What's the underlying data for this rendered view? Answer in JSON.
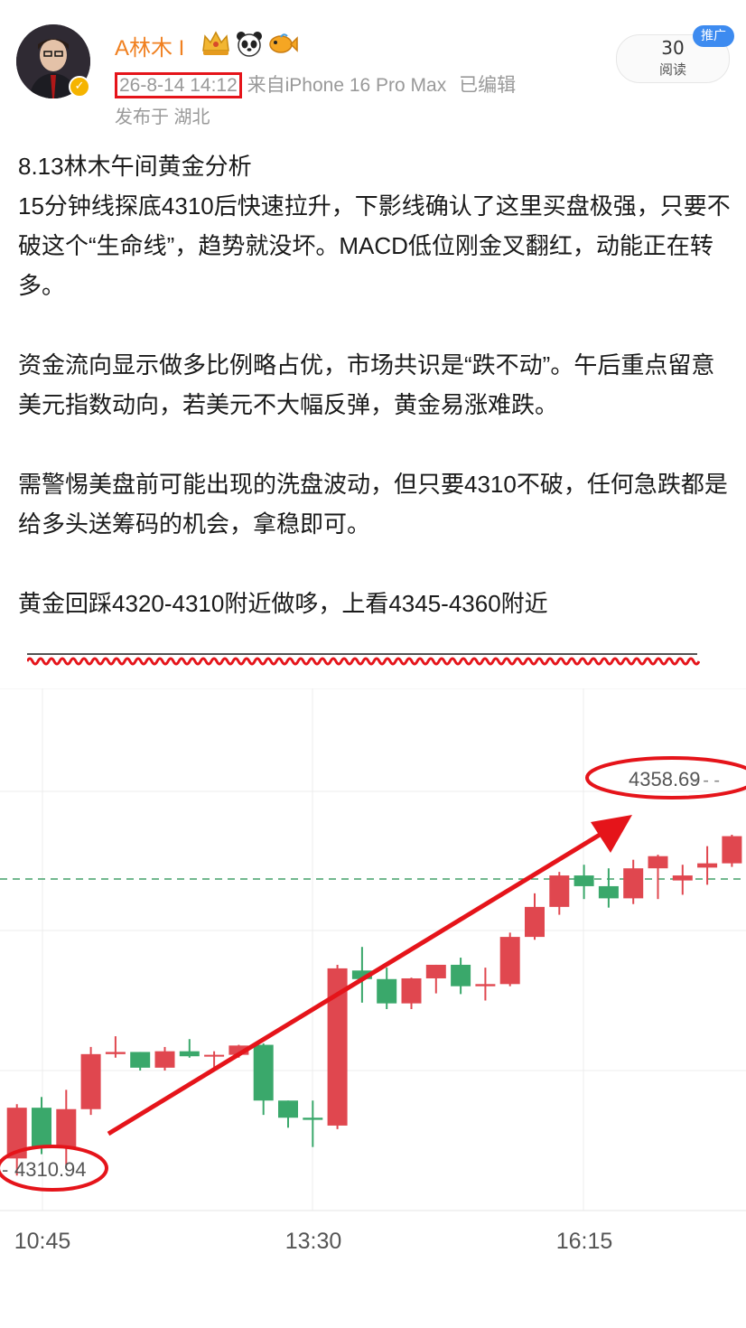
{
  "post": {
    "username": "A林木 I",
    "timestamp": "26-8-14 14:12",
    "source": "来自iPhone 16 Pro Max",
    "edited": "已编辑",
    "location": "发布于 湖北",
    "reads_count": "30",
    "reads_label": "阅读",
    "promo_badge": "推广",
    "paragraphs": [
      "8.13林木午间黄金分析\n15分钟线探底4310后快速拉升，下影线确认了这里买盘极强，只要不破这个“生命线”，趋势就没坏。MACD低位刚金叉翻红，动能正在转多。",
      "资金流向显示做多比例略占优，市场共识是“跌不动”。午后重点留意美元指数动向，若美元不大幅反弹，黄金易涨难跌。",
      "需警惕美盘前可能出现的洗盘波动，但只要4310不破，任何急跌都是给多头送筹码的机会，拿稳即可。",
      "黄金回踩4320-4310附近做哆，上看4345-4360附近"
    ]
  },
  "icons": {
    "badges": [
      "crown-icon",
      "panda-icon",
      "fish-icon"
    ],
    "verified": "verified-icon"
  },
  "colors": {
    "username": "#f08020",
    "annotation_red": "#e5141a",
    "bull": "#e0474f",
    "bear": "#3aa86b",
    "promo": "#3d8bf0"
  },
  "chart_data": {
    "type": "candlestick",
    "x_ticks": [
      "10:45",
      "13:30",
      "16:15"
    ],
    "price_labels": {
      "high": "4358.69",
      "low": "4310.94"
    },
    "reference_line": 4350,
    "candles": [
      {
        "o": 4310.9,
        "h": 4318.5,
        "l": 4308.5,
        "c": 4318.0
      },
      {
        "o": 4318.0,
        "h": 4319.5,
        "l": 4311.5,
        "c": 4312.5
      },
      {
        "o": 4312.5,
        "h": 4320.5,
        "l": 4310.0,
        "c": 4317.8
      },
      {
        "o": 4317.8,
        "h": 4326.5,
        "l": 4317.0,
        "c": 4325.5
      },
      {
        "o": 4325.5,
        "h": 4328.0,
        "l": 4325.0,
        "c": 4325.8
      },
      {
        "o": 4325.8,
        "h": 4325.8,
        "l": 4323.2,
        "c": 4323.6
      },
      {
        "o": 4323.6,
        "h": 4326.5,
        "l": 4323.2,
        "c": 4325.9
      },
      {
        "o": 4325.9,
        "h": 4327.6,
        "l": 4325.0,
        "c": 4325.2
      },
      {
        "o": 4325.2,
        "h": 4325.9,
        "l": 4323.4,
        "c": 4325.4
      },
      {
        "o": 4325.4,
        "h": 4326.8,
        "l": 4325.0,
        "c": 4326.7
      },
      {
        "o": 4326.8,
        "h": 4327.0,
        "l": 4317.0,
        "c": 4319.0
      },
      {
        "o": 4319.0,
        "h": 4319.0,
        "l": 4315.2,
        "c": 4316.6
      },
      {
        "o": 4316.6,
        "h": 4319.0,
        "l": 4312.5,
        "c": 4316.3
      },
      {
        "o": 4315.5,
        "h": 4338.0,
        "l": 4315.0,
        "c": 4337.5
      },
      {
        "o": 4337.2,
        "h": 4340.5,
        "l": 4332.7,
        "c": 4336.0
      },
      {
        "o": 4336.0,
        "h": 4337.6,
        "l": 4331.8,
        "c": 4332.6
      },
      {
        "o": 4332.6,
        "h": 4336.2,
        "l": 4331.8,
        "c": 4336.1
      },
      {
        "o": 4336.1,
        "h": 4338.0,
        "l": 4334.0,
        "c": 4338.0
      },
      {
        "o": 4338.0,
        "h": 4339.0,
        "l": 4333.9,
        "c": 4335.0
      },
      {
        "o": 4335.0,
        "h": 4337.6,
        "l": 4333.0,
        "c": 4335.3
      },
      {
        "o": 4335.3,
        "h": 4342.5,
        "l": 4335.0,
        "c": 4341.9
      },
      {
        "o": 4341.9,
        "h": 4348.0,
        "l": 4341.5,
        "c": 4346.1
      },
      {
        "o": 4346.1,
        "h": 4351.0,
        "l": 4345.0,
        "c": 4350.5
      },
      {
        "o": 4350.5,
        "h": 4352.0,
        "l": 4347.2,
        "c": 4349.0
      },
      {
        "o": 4349.0,
        "h": 4351.5,
        "l": 4346.0,
        "c": 4347.3
      },
      {
        "o": 4347.3,
        "h": 4352.7,
        "l": 4346.5,
        "c": 4351.5
      },
      {
        "o": 4351.5,
        "h": 4353.4,
        "l": 4347.2,
        "c": 4353.2
      },
      {
        "o": 4349.8,
        "h": 4352.0,
        "l": 4347.8,
        "c": 4350.5
      },
      {
        "o": 4351.6,
        "h": 4354.6,
        "l": 4349.2,
        "c": 4352.2
      },
      {
        "o": 4352.2,
        "h": 4356.2,
        "l": 4351.7,
        "c": 4356.0
      }
    ]
  }
}
